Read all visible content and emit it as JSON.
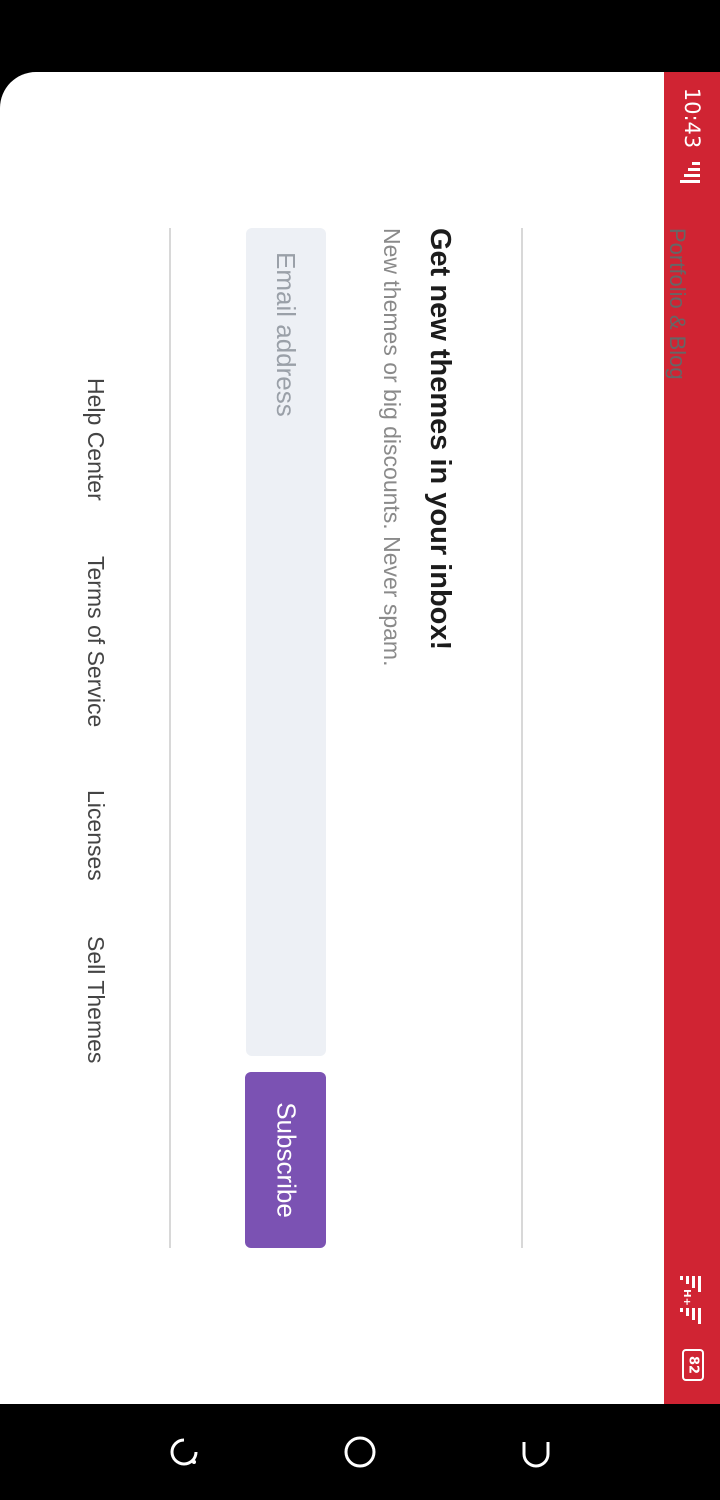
{
  "status_bar": {
    "time": "10:43",
    "battery": "82",
    "network_label": "H+",
    "background_color": "#d02433"
  },
  "cut_off_text": "Portfolio & Blog",
  "newsletter": {
    "title": "Get new themes in your inbox!",
    "subtitle": "New themes or big discounts. Never spam.",
    "email_placeholder": "Email address",
    "subscribe_label": "Subscribe",
    "accent_color": "#7b52b3"
  },
  "footer": {
    "links": [
      "Help Center",
      "Terms of Service",
      "Licenses",
      "Sell Themes"
    ]
  },
  "nav_bar": {
    "buttons": [
      "recent-apps-icon",
      "home-icon",
      "back-icon"
    ]
  }
}
